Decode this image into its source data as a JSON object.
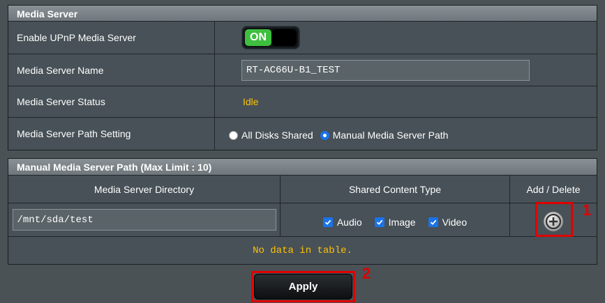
{
  "media_server": {
    "header": "Media Server",
    "rows": {
      "upnp": {
        "label": "Enable UPnP Media Server",
        "toggle_on_label": "ON"
      },
      "name": {
        "label": "Media Server Name",
        "value": "RT-AC66U-B1_TEST"
      },
      "status": {
        "label": "Media Server Status",
        "value": "Idle"
      },
      "path_setting": {
        "label": "Media Server Path Setting",
        "options": [
          "All Disks Shared",
          "Manual Media Server Path"
        ],
        "selected": "Manual Media Server Path"
      }
    }
  },
  "manual_path": {
    "header": "Manual Media Server Path (Max Limit : 10)",
    "columns": [
      "Media Server Directory",
      "Shared Content Type",
      "Add / Delete"
    ],
    "directory_value": "/mnt/sda/test",
    "content_types": [
      "Audio",
      "Image",
      "Video"
    ],
    "empty_message": "No data in table."
  },
  "apply_label": "Apply",
  "annotations": [
    "1",
    "2"
  ],
  "colors": {
    "accent_yellow": "#ffc107",
    "toggle_green": "#3fbf3f",
    "annotation_red": "#e00000",
    "check_blue": "#1a73e8"
  }
}
